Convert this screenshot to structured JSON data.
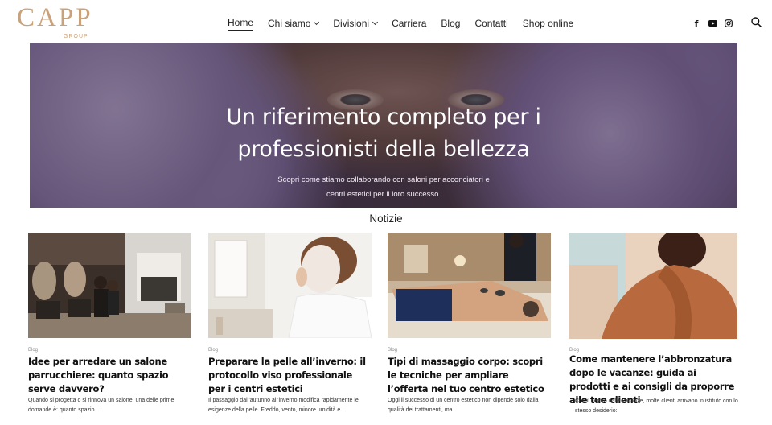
{
  "brand": {
    "name": "CAPP",
    "sub": "GROUP"
  },
  "nav": [
    {
      "label": "Home",
      "active": true,
      "dropdown": false
    },
    {
      "label": "Chi siamo",
      "active": false,
      "dropdown": true
    },
    {
      "label": "Divisioni",
      "active": false,
      "dropdown": true
    },
    {
      "label": "Carriera",
      "active": false,
      "dropdown": false
    },
    {
      "label": "Blog",
      "active": false,
      "dropdown": false
    },
    {
      "label": "Contatti",
      "active": false,
      "dropdown": false
    },
    {
      "label": "Shop online",
      "active": false,
      "dropdown": false
    }
  ],
  "social": {
    "facebook": "f",
    "youtube": "youtube-icon",
    "instagram": "instagram-icon",
    "search": "search-icon"
  },
  "hero": {
    "title_line1": "Un riferimento completo per i",
    "title_line2": "professionisti della bellezza",
    "text_line1": "Scopri come stiamo collaborando con saloni per acconciatori e",
    "text_line2": "centri estetici per il loro successo."
  },
  "news": {
    "heading": "Notizie",
    "items": [
      {
        "category": "Blog",
        "title": "Idee per arredare un salone parrucchiere: quanto spazio serve davvero?",
        "excerpt": "Quando si progetta o si rinnova un salone, una delle prime domande è: quanto spazio..."
      },
      {
        "category": "Blog",
        "title": "Preparare la pelle all’inverno: il protocollo viso professionale per i centri estetici",
        "excerpt": "Il passaggio dall’autunno all’inverno modifica rapidamente le esigenze della pelle. Freddo, vento, minore umidità e..."
      },
      {
        "category": "Blog",
        "title": "Tipi di massaggio corpo: scopri le tecniche per ampliare l’offerta nel tuo centro estetico",
        "excerpt": "Oggi il successo di un centro estetico non dipende solo dalla qualità dei trattamenti, ma..."
      },
      {
        "category": "Blog",
        "title": "Come mantenere l’abbronzatura dopo le vacanze: guida ai prodotti e ai consigli da proporre alle tue clienti",
        "excerpt": "Con il rientro dalle vacanze, molte clienti arrivano in istituto con lo stesso desiderio:"
      }
    ]
  },
  "colors": {
    "brand": "#c9a27a",
    "text": "#111111"
  }
}
